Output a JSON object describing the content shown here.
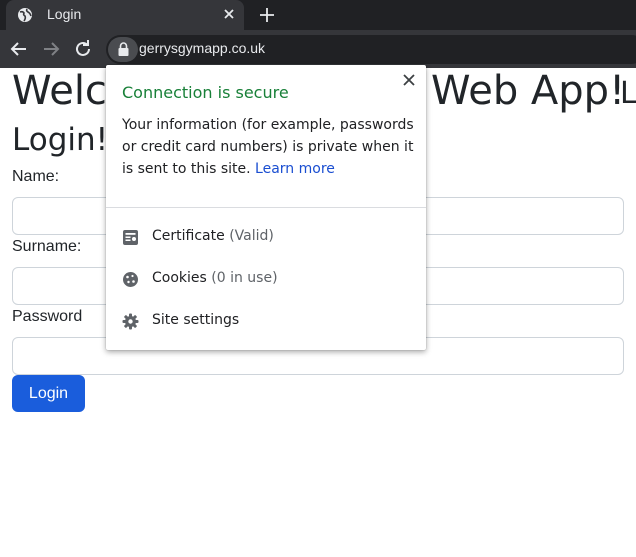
{
  "browser": {
    "tab_title": "Login",
    "url": "gerrysgymapp.co.uk"
  },
  "page": {
    "heading_left": "Welc",
    "heading_right": "Web App!",
    "heading_trailing": "L",
    "login_heading": "Login!",
    "name_label": "Name:",
    "surname_label": "Surname:",
    "password_label": "Password",
    "login_button": "Login"
  },
  "popup": {
    "title": "Connection is secure",
    "body": "Your information (for example, passwords or credit card numbers) is private when it is sent to this site.",
    "learn_more": "Learn more",
    "rows": [
      {
        "label": "Certificate",
        "sub": "(Valid)",
        "icon": "certificate-icon"
      },
      {
        "label": "Cookies",
        "sub": "(0 in use)",
        "icon": "cookie-icon"
      },
      {
        "label": "Site settings",
        "sub": "",
        "icon": "gear-icon"
      }
    ]
  },
  "colors": {
    "secure_green": "#188038",
    "link_blue": "#1a4ed1",
    "button_blue": "#1a5ddc"
  }
}
